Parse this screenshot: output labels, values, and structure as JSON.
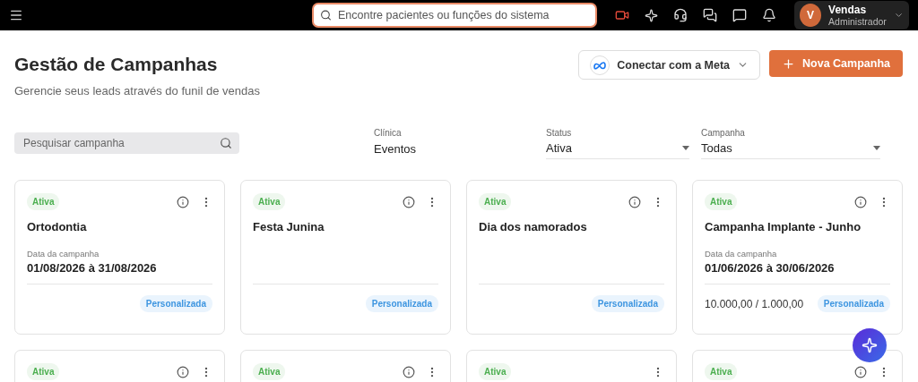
{
  "topbar": {
    "search": {
      "placeholder": "Encontre pacientes ou funções do sistema"
    },
    "user": {
      "initial": "V",
      "name": "Vendas",
      "role": "Administrador"
    }
  },
  "header": {
    "title": "Gestão de Campanhas",
    "subtitle": "Gerencie seus leads através do funil de vendas",
    "meta_button": "Conectar com a Meta",
    "new_button": "Nova Campanha"
  },
  "filters": {
    "search": {
      "placeholder": "Pesquisar campanha"
    },
    "clinic": {
      "label": "Clínica",
      "value": "Eventos"
    },
    "status": {
      "label": "Status",
      "value": "Ativa"
    },
    "campaign": {
      "label": "Campanha",
      "value": "Todas"
    }
  },
  "cards": [
    {
      "status": "Ativa",
      "info": true,
      "name": "Ortodontia",
      "date_label": "Data da campanha",
      "date": "01/08/2026 à 31/08/2026",
      "type": "Personalizada"
    },
    {
      "status": "Ativa",
      "info": true,
      "name": "Festa Junina",
      "type": "Personalizada"
    },
    {
      "status": "Ativa",
      "info": true,
      "name": "Dia dos namorados",
      "type": "Personalizada"
    },
    {
      "status": "Ativa",
      "info": true,
      "name": "Campanha Implante - Junho",
      "date_label": "Data da campanha",
      "date": "01/06/2026 à 30/06/2026",
      "budget": "10.000,00 / 1.000,00",
      "type": "Personalizada"
    },
    {
      "status": "Ativa",
      "info": true
    },
    {
      "status": "Ativa",
      "info": true
    },
    {
      "status": "Ativa",
      "info": false
    },
    {
      "status": "Ativa",
      "info": true
    }
  ]
}
